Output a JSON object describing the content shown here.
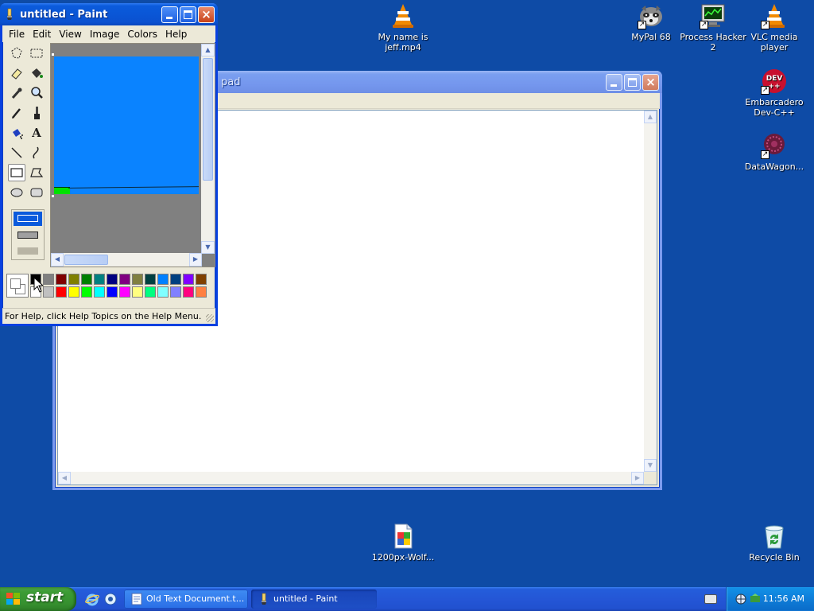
{
  "desktop": {
    "icons": [
      {
        "label": "My name is jeff.mp4"
      },
      {
        "label": "MyPal 68"
      },
      {
        "label": "Process Hacker 2"
      },
      {
        "label": "VLC media player"
      },
      {
        "label": "Embarcadero Dev-C++"
      },
      {
        "label": "DataWagon..."
      },
      {
        "label": "1200px-Wolf..."
      },
      {
        "label": "Recycle Bin"
      }
    ]
  },
  "notepad": {
    "title_fragment": "pad"
  },
  "paint": {
    "title": "untitled - Paint",
    "menu": [
      "File",
      "Edit",
      "View",
      "Image",
      "Colors",
      "Help"
    ],
    "status": "For Help, click Help Topics on the Help Menu.",
    "palette_row1": [
      "#000000",
      "#808080",
      "#800000",
      "#808000",
      "#008000",
      "#008080",
      "#000080",
      "#800080",
      "#808040",
      "#004040",
      "#0080ff",
      "#004080",
      "#8000ff",
      "#804000"
    ],
    "palette_row2": [
      "#ffffff",
      "#c0c0c0",
      "#ff0000",
      "#ffff00",
      "#00ff00",
      "#00ffff",
      "#0000ff",
      "#ff00ff",
      "#ffff80",
      "#00ff80",
      "#80ffff",
      "#8080ff",
      "#ff0080",
      "#ff8040"
    ],
    "canvas_color": "#0a83ff",
    "accent_green": "#00e000"
  },
  "taskbar": {
    "start_label": "start",
    "tasks": [
      {
        "label": "Old Text Document.t..."
      },
      {
        "label": "untitled - Paint"
      }
    ],
    "clock": "11:56 AM"
  }
}
